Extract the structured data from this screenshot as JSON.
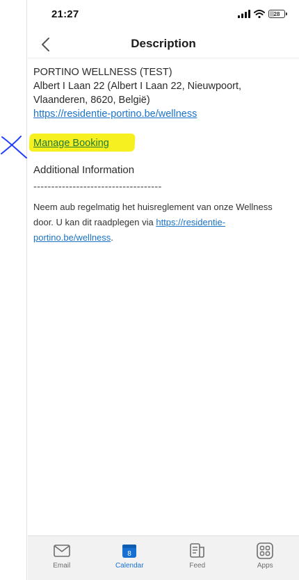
{
  "status_bar": {
    "time": "21:27",
    "battery_level": "28"
  },
  "nav": {
    "title": "Description",
    "back_icon": "chevron-left-icon"
  },
  "content": {
    "venue_name": "PORTINO WELLNESS (TEST)",
    "address_line1": "Albert I Laan 22 (Albert I Laan 22, Nieuwpoort,",
    "address_line2": "Vlaanderen, 8620, België)",
    "website_link": "https://residentie-portino.be/wellness",
    "manage_booking_link": "Manage Booking",
    "section_title": "Additional Information",
    "separator": "------------------------------------",
    "info_text_part1": "Neem aub regelmatig het huisreglement van onze Wellness door. U kan dit raadplegen via ",
    "info_link": "https://residentie-portino.be/wellness",
    "info_text_part2": "."
  },
  "tab_bar": {
    "tabs": [
      {
        "label": "Email",
        "icon": "mail-icon",
        "active": false
      },
      {
        "label": "Calendar",
        "icon": "calendar-icon",
        "active": true,
        "badge": "8"
      },
      {
        "label": "Feed",
        "icon": "feed-icon",
        "active": false
      },
      {
        "label": "Apps",
        "icon": "apps-grid-icon",
        "active": false
      }
    ]
  },
  "colors": {
    "link": "#1a73c7",
    "highlight": "#f6f021",
    "annotation_x": "#1f3cff",
    "active_tab": "#1770d1"
  }
}
